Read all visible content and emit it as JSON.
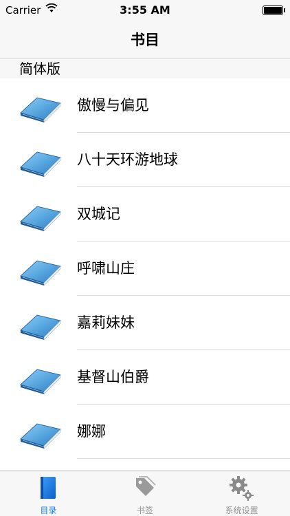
{
  "status_bar": {
    "carrier": "Carrier",
    "time": "3:55 AM",
    "battery_level": 1.0
  },
  "nav": {
    "title": "书目"
  },
  "section": {
    "header": "简体版"
  },
  "books": [
    {
      "title": "傲慢与偏见",
      "icon": "book-icon"
    },
    {
      "title": "八十天环游地球",
      "icon": "book-icon"
    },
    {
      "title": "双城记",
      "icon": "book-icon"
    },
    {
      "title": "呼啸山庄",
      "icon": "book-icon"
    },
    {
      "title": "嘉莉妹妹",
      "icon": "book-icon"
    },
    {
      "title": "基督山伯爵",
      "icon": "book-icon"
    },
    {
      "title": "娜娜",
      "icon": "book-icon"
    }
  ],
  "tab_bar": {
    "items": [
      {
        "label": "目录",
        "icon": "book-icon",
        "active": true
      },
      {
        "label": "书签",
        "icon": "tag-icon",
        "active": false
      },
      {
        "label": "系统设置",
        "icon": "gear-icon",
        "active": false
      }
    ]
  },
  "colors": {
    "accent": "#1a7ff0",
    "inactive": "#929292",
    "bar_background": "#f7f7f7",
    "book_blue": "#5aa8e0"
  }
}
